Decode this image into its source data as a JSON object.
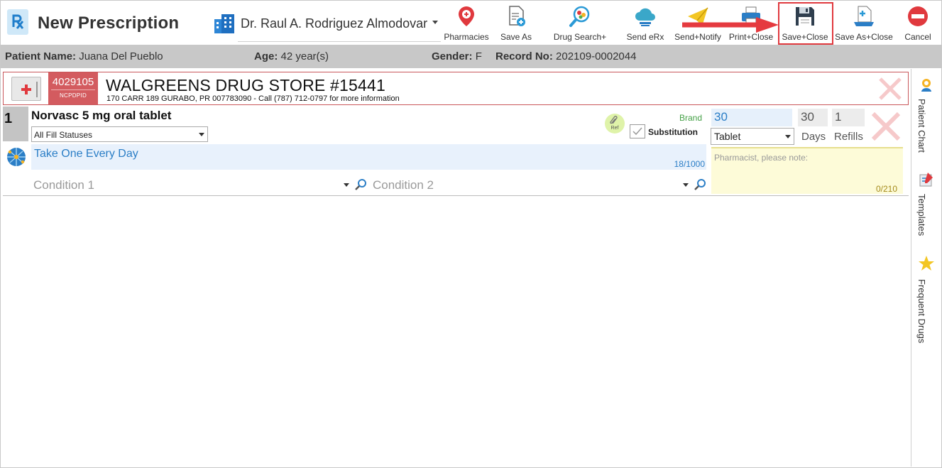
{
  "header": {
    "title": "New Prescription",
    "doctor": "Dr. Raul A. Rodriguez Almodovar"
  },
  "toolbar": {
    "pharmacies": "Pharmacies",
    "save_as": "Save As",
    "drug_search": "Drug Search+",
    "send_erx": "Send eRx",
    "send_notify": "Send+Notify",
    "print_close": "Print+Close",
    "save_close": "Save+Close",
    "save_as_close": "Save As+Close",
    "cancel": "Cancel"
  },
  "patient": {
    "name_label": "Patient Name:",
    "name": "Juana Del Pueblo",
    "age_label": "Age:",
    "age": "42 year(s)",
    "gender_label": "Gender:",
    "gender": "F",
    "record_label": "Record No:",
    "record": "202109-0002044"
  },
  "pharmacy": {
    "id": "4029105",
    "id_type": "NCPDPID",
    "name": "WALGREENS DRUG STORE #15441",
    "address": "170 CARR 189 GURABO, PR 007783090 - Call (787) 712-0797 for more information"
  },
  "drug": {
    "number": "1",
    "name": "Norvasc 5 mg oral tablet",
    "fill_status": "All Fill Statuses",
    "ref_label": "Ref",
    "brand_label": "Brand",
    "substitution_label": "Substitution",
    "quantity": "30",
    "days": "30",
    "refills": "1",
    "form": "Tablet",
    "days_label": "Days",
    "refills_label": "Refills",
    "sig": "Take One Every Day",
    "sig_count": "18/1000",
    "note_placeholder": "Pharmacist, please note:",
    "note_count": "0/210",
    "condition1": "Condition 1",
    "condition2": "Condition 2"
  },
  "sidebar": {
    "patient_chart": "Patient Chart",
    "templates": "Templates",
    "frequent_drugs": "Frequent Drugs"
  },
  "colors": {
    "highlight": "#e0393e",
    "pharmacy_red": "#d35b5f",
    "sig_blue": "#2b7ec6"
  }
}
